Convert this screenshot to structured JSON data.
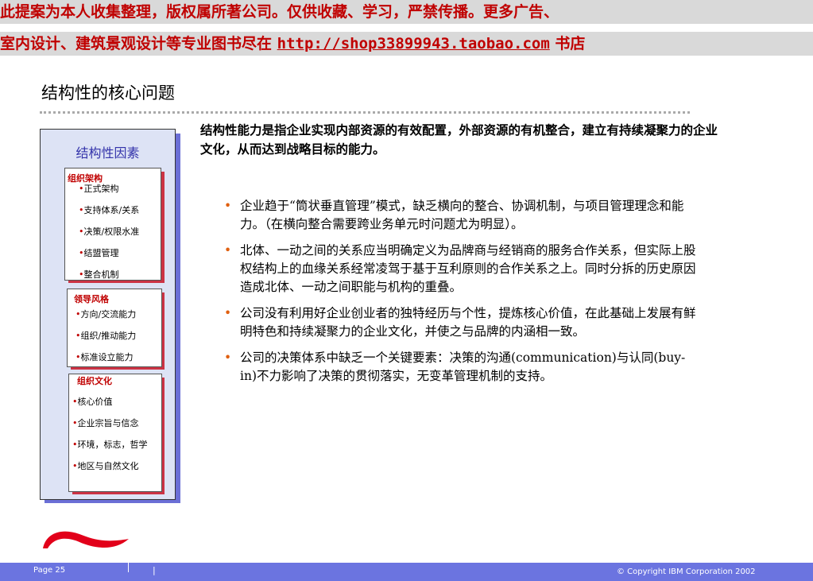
{
  "banner": {
    "line1": "此提案为本人收集整理，版权属所著公司。仅供收藏、学习，严禁传播。更多广告、",
    "line2_prefix": "室内设计、建筑景观设计等专业图书尽在 ",
    "line2_link": "http://shop33899943.taobao.com",
    "line2_suffix": " 书店"
  },
  "title": "结构性的核心问题",
  "intro": "结构性能力是指企业实现内部资源的有效配置，外部资源的有机整合，建立有持续凝聚力的企业文化，从而达到战略目标的能力。",
  "factors": {
    "title": "结构性因素",
    "groups": [
      {
        "header": "组织架构",
        "items": [
          "正式架构",
          "支持体系/关系",
          "决策/权限水准",
          "结盟管理",
          "整合机制"
        ]
      },
      {
        "header": "领导风格",
        "items": [
          "方向/交流能力",
          "组织/推动能力",
          "标准设立能力"
        ]
      },
      {
        "header": "组织文化",
        "items": [
          "核心价值",
          "企业宗旨与信念",
          "环境，标志，哲学",
          "地区与自然文化"
        ]
      }
    ]
  },
  "bullets": [
    "企业趋于“筒状垂直管理”模式，缺乏横向的整合、协调机制，与项目管理理念和能力。（在横向整合需要跨业务单元时问题尤为明显）。",
    "北体、一动之间的关系应当明确定义为品牌商与经销商的服务合作关系，但实际上股权结构上的血缘关系经常凌驾于基于互利原则的合作关系之上。同时分拆的历史原因造成北体、一动之间职能与机构的重叠。",
    "公司没有利用好企业创业者的独特经历与个性，提炼核心价值，在此基础上发展有鲜明特色和持续凝聚力的企业文化，并使之与品牌的内涵相一致。",
    "公司的决策体系中缺乏一个关键要素：决策的沟通(communication)与认同(buy-in)不力影响了决策的贯彻落实，无变革管理机制的支持。"
  ],
  "footer": {
    "page": "Page 25",
    "separator": "|",
    "copyright": "© Copyright IBM Corporation 2002"
  },
  "colors": {
    "banner_text": "#c00000",
    "footer_bar": "#6b74e0",
    "bullet_dot": "#e06010",
    "logo": "#e2001a"
  },
  "icons": {
    "logo": "brand-swoosh-logo"
  }
}
